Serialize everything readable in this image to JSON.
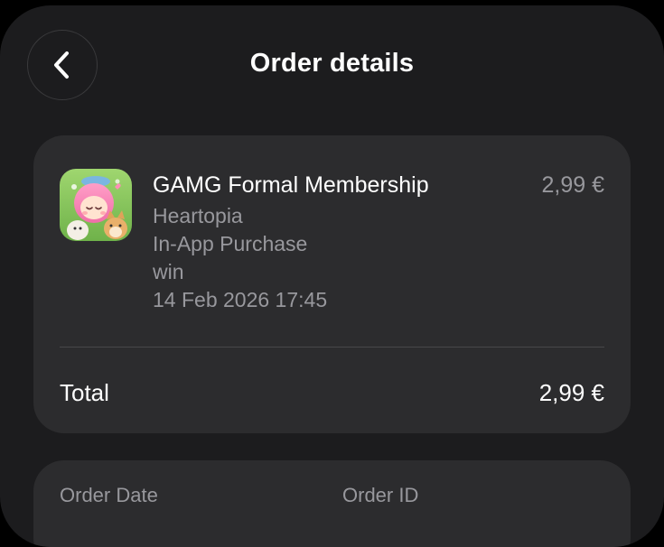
{
  "header": {
    "title": "Order details",
    "back_icon": "chevron-left-icon"
  },
  "order_item": {
    "name": "GAMG Formal Membership",
    "price": "2,99 €",
    "app_name": "Heartopia",
    "purchase_type": "In-App Purchase",
    "platform": "win",
    "datetime": "14 Feb 2026 17:45",
    "icon": "heartopia-app-icon"
  },
  "summary": {
    "total_label": "Total",
    "total_value": "2,99 €"
  },
  "info": {
    "order_date_label": "Order Date",
    "order_id_label": "Order ID"
  },
  "colors": {
    "background": "#1c1c1e",
    "card": "#2c2c2e",
    "primary_text": "#ffffff",
    "secondary_text": "#98989d"
  }
}
